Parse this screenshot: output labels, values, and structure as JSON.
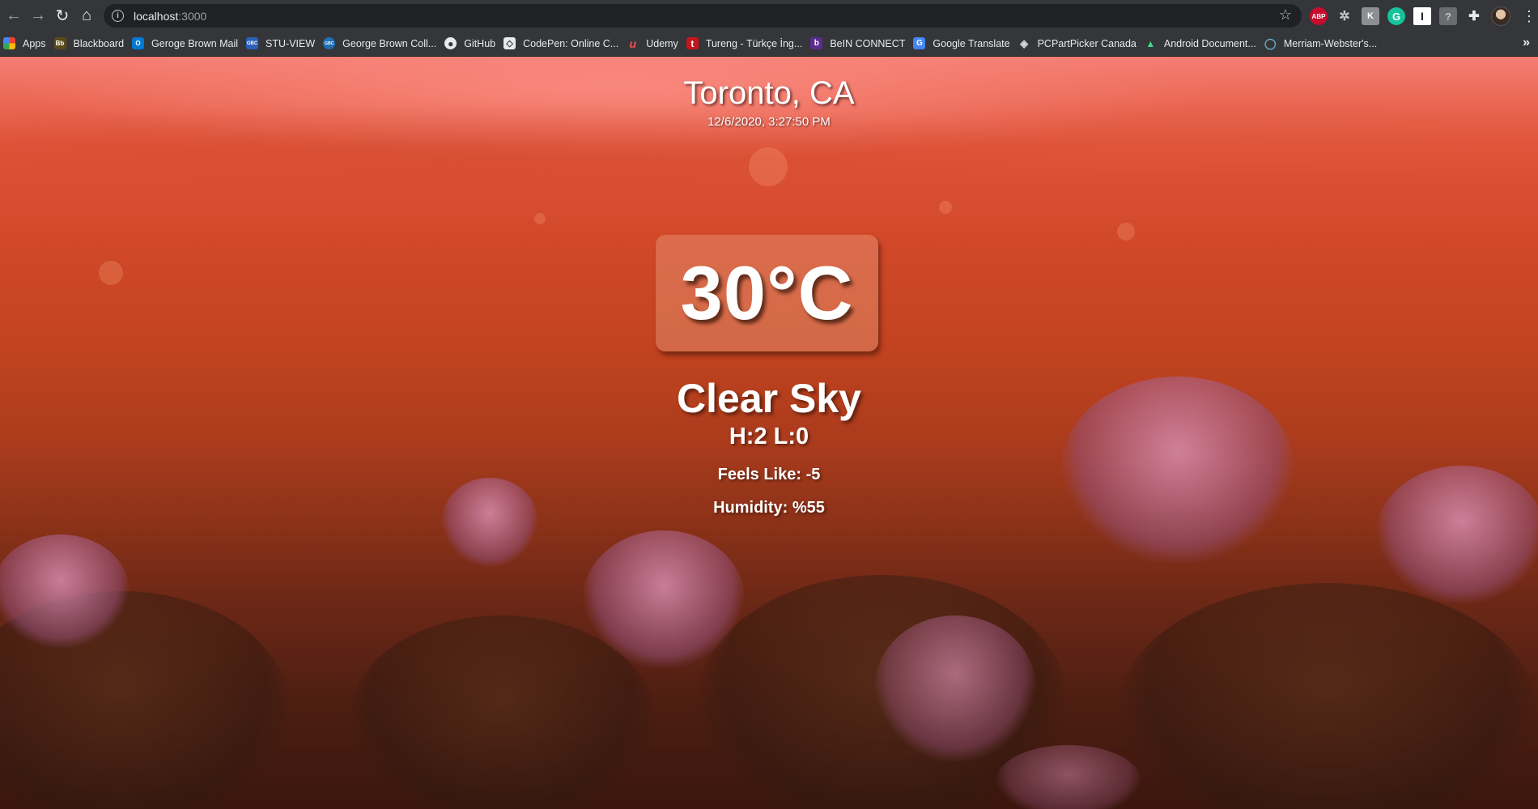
{
  "browser": {
    "url_host": "localhost",
    "url_port": ":3000",
    "extensions": [
      "abp-icon",
      "gear-extension-icon",
      "k-extension-icon",
      "grammarly-icon",
      "i-extension-icon",
      "help-extension-icon",
      "puzzle-icon"
    ],
    "extension_labels": {
      "abp": "ABP",
      "k": "K",
      "grammarly": "G",
      "i": "I",
      "help": "?"
    }
  },
  "bookmarks": [
    {
      "label": "Apps",
      "icon": "apps-grid-icon",
      "color": "#ea4335"
    },
    {
      "label": "Blackboard",
      "icon": "blackboard-icon",
      "color": "#5a4a1a",
      "glyph": "Bb"
    },
    {
      "label": "Geroge Brown Mail",
      "icon": "outlook-icon",
      "color": "#0078d4",
      "glyph": "O"
    },
    {
      "label": "STU-VIEW",
      "icon": "stu-view-icon",
      "color": "#2b5fb8",
      "glyph": "GBC"
    },
    {
      "label": "George Brown Coll...",
      "icon": "gbc-icon",
      "color": "#1f6fb5",
      "glyph": "GBC"
    },
    {
      "label": "GitHub",
      "icon": "github-icon",
      "color": "#35363a",
      "glyph": "●"
    },
    {
      "label": "CodePen: Online C...",
      "icon": "codepen-icon",
      "color": "#35363a",
      "glyph": "◇"
    },
    {
      "label": "Udemy",
      "icon": "udemy-icon",
      "color": "#35363a",
      "glyph": "u"
    },
    {
      "label": "Tureng - Türkçe İng...",
      "icon": "tureng-icon",
      "color": "#c4161c",
      "glyph": "t"
    },
    {
      "label": "BeIN CONNECT",
      "icon": "bein-icon",
      "color": "#5b2d8e",
      "glyph": "b"
    },
    {
      "label": "Google Translate",
      "icon": "google-translate-icon",
      "color": "#4285f4",
      "glyph": "G"
    },
    {
      "label": "PCPartPicker Canada",
      "icon": "pcpartpicker-icon",
      "color": "#35363a",
      "glyph": "◈"
    },
    {
      "label": "Android Document...",
      "icon": "android-icon",
      "color": "#35363a",
      "glyph": "▲"
    },
    {
      "label": "Merriam-Webster's...",
      "icon": "globe-icon",
      "color": "#35363a",
      "glyph": "◯"
    }
  ],
  "weather": {
    "city": "Toronto, CA",
    "datetime": "12/6/2020, 3:27:50 PM",
    "temperature": "30°C",
    "condition": "Clear Sky",
    "hilo": "H:2 L:0",
    "feels_like": "Feels Like: -5",
    "humidity": "Humidity: %55"
  },
  "colors": {
    "chrome_bg": "#35363a",
    "omnibox_bg": "#202124",
    "sky_top": "#f47d74",
    "sky_mid": "#d2492a",
    "ground": "#3a160e",
    "flower": "#d78caf"
  }
}
